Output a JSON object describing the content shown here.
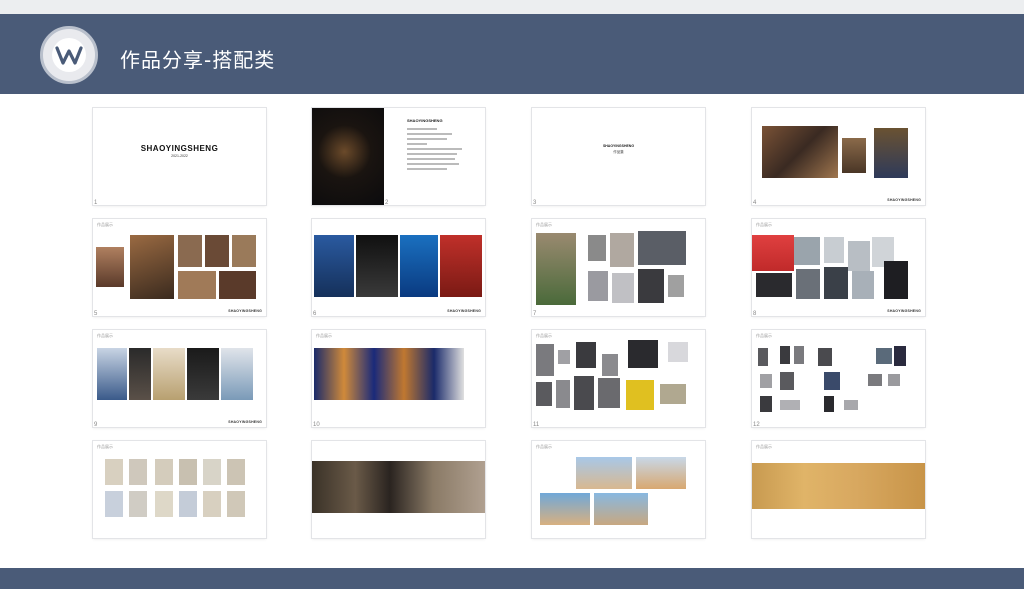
{
  "header": {
    "title": "作品分享-搭配类",
    "logo_icon": "wps-w-logo-icon",
    "color": "#4a5b78"
  },
  "slides": [
    {
      "num": "1",
      "cover_title": "SHAOYINGSHENG",
      "cover_sub": "2021-2022"
    },
    {
      "num": "2",
      "heading": "SHAOYINGSHENG"
    },
    {
      "num": "3",
      "section_title": "SHAOYINGSHENG",
      "section_sub": "作品集"
    },
    {
      "num": "4",
      "mark": "SHAOYINGSHENG"
    },
    {
      "num": "5",
      "tag": "作品展示",
      "mark": "SHAOYINGSHENG"
    },
    {
      "num": "6",
      "mark": "SHAOYINGSHENG"
    },
    {
      "num": "7",
      "tag": "作品展示"
    },
    {
      "num": "8",
      "tag": "作品展示",
      "mark": "SHAOYINGSHENG"
    },
    {
      "num": "9",
      "tag": "作品展示",
      "mark": "SHAOYINGSHENG"
    },
    {
      "num": "10",
      "tag": "作品展示"
    },
    {
      "num": "11",
      "tag": "作品展示"
    },
    {
      "num": "12",
      "tag": "作品展示"
    },
    {
      "num": "",
      "tag": "作品展示"
    },
    {
      "num": "",
      "tag": ""
    },
    {
      "num": "",
      "tag": "作品展示"
    },
    {
      "num": "",
      "tag": "作品展示"
    }
  ]
}
